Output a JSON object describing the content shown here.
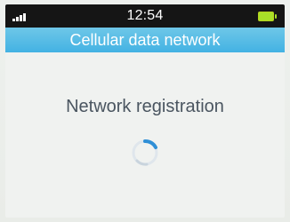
{
  "status_bar": {
    "time": "12:54",
    "signal_icon": "signal-strength-icon",
    "battery_icon": "battery-full-icon"
  },
  "header": {
    "title": "Cellular data network"
  },
  "main": {
    "message": "Network registration",
    "spinner_icon": "loading-spinner-icon"
  },
  "colors": {
    "status_bar": "#151515",
    "title_bar": "#43b2e3",
    "battery": "#a8e028",
    "text": "#4a5560",
    "spinner": "#2f8fd6"
  }
}
